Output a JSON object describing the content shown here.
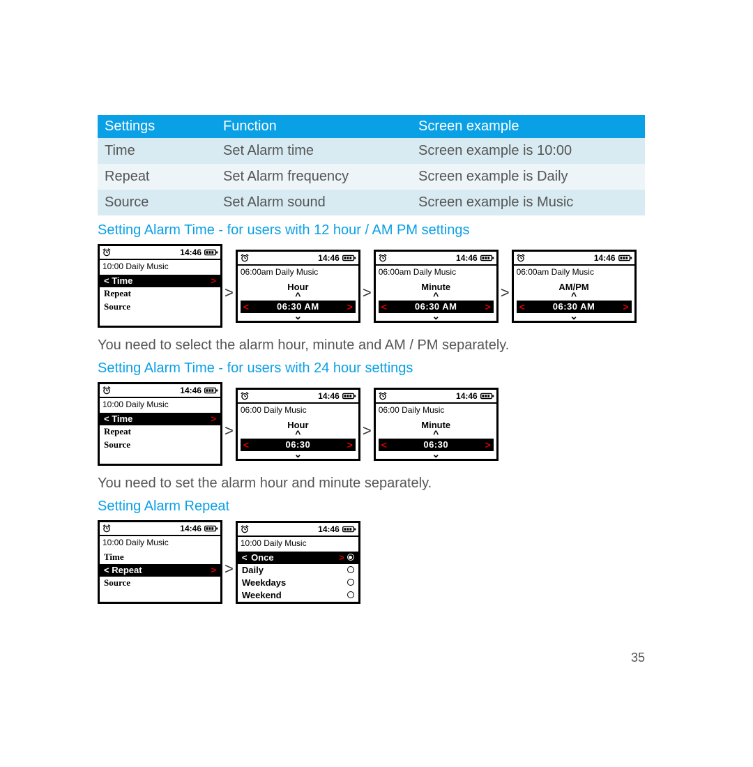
{
  "table": {
    "headers": [
      "Settings",
      "Function",
      "Screen example"
    ],
    "rows": [
      [
        "Time",
        "Set Alarm time",
        "Screen example is 10:00"
      ],
      [
        "Repeat",
        "Set Alarm frequency",
        "Screen example is Daily"
      ],
      [
        "Source",
        "Set Alarm sound",
        "Screen example is Music"
      ]
    ]
  },
  "clock_time": "14:46",
  "headings": {
    "h12": "Setting Alarm Time - for users with 12 hour / AM PM settings",
    "h24": "Setting Alarm Time - for users with 24 hour settings",
    "repeat": "Setting Alarm Repeat"
  },
  "body": {
    "p12": "You need to select the alarm hour, minute and AM / PM separately.",
    "p24": "You need to set the alarm hour and minute separately."
  },
  "screens_12h": [
    {
      "info": "10:00 Daily Music",
      "type": "menu",
      "selected": "Time",
      "items": [
        "Repeat",
        "Source"
      ]
    },
    {
      "info": "06:00am Daily Music",
      "type": "spinner",
      "label": "Hour",
      "value": "06:30  AM"
    },
    {
      "info": "06:00am Daily Music",
      "type": "spinner",
      "label": "Minute",
      "value": "06:30  AM"
    },
    {
      "info": "06:00am Daily Music",
      "type": "spinner",
      "label": "AM/PM",
      "value": "06:30  AM"
    }
  ],
  "screens_24h": [
    {
      "info": "10:00 Daily Music",
      "type": "menu",
      "selected": "Time",
      "items": [
        "Repeat",
        "Source"
      ]
    },
    {
      "info": "06:00 Daily Music",
      "type": "spinner",
      "label": "Hour",
      "value": "06:30"
    },
    {
      "info": "06:00 Daily Music",
      "type": "spinner",
      "label": "Minute",
      "value": "06:30"
    }
  ],
  "screens_repeat": [
    {
      "info": "10:00 Daily Music",
      "type": "menu",
      "selected": "Repeat",
      "items_pre": [
        "Time"
      ],
      "items_post": [
        "Source"
      ]
    },
    {
      "info": "10:00 Daily Music",
      "type": "options",
      "selected": "Once",
      "options": [
        "Once",
        "Daily",
        "Weekdays",
        "Weekend"
      ]
    }
  ],
  "page_number": "35"
}
